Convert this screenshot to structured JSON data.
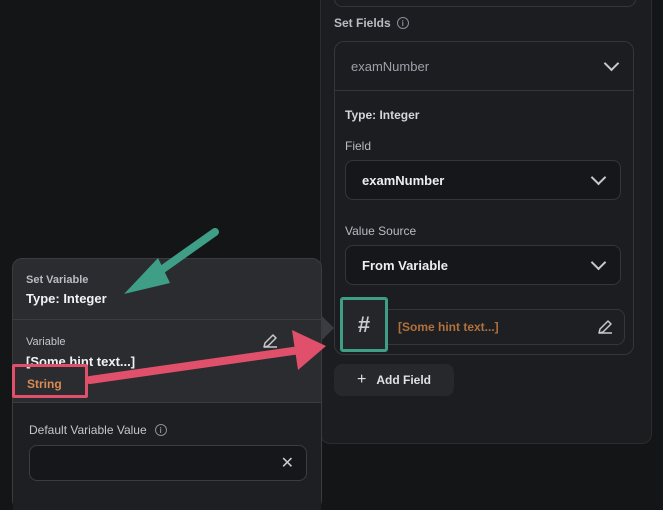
{
  "right_panel": {
    "set_fields_label": "Set Fields",
    "field_header": "examNumber",
    "type_line": "Type: Integer",
    "field_label": "Field",
    "field_value": "examNumber",
    "value_source_label": "Value Source",
    "value_source_value": "From Variable",
    "variable_hint": "[Some hint text...]",
    "hash_symbol": "#",
    "add_field_label": "Add Field"
  },
  "popover": {
    "title": "Set Variable",
    "type_line": "Type: Integer",
    "variable_label": "Variable",
    "variable_value": "[Some hint text...]",
    "string_tag": "String",
    "default_value_label": "Default Variable Value",
    "clear_symbol": "✕"
  },
  "colors": {
    "annotation_green": "#3f9e86",
    "annotation_red": "#e0506a",
    "hint_orange": "#b2703d"
  }
}
